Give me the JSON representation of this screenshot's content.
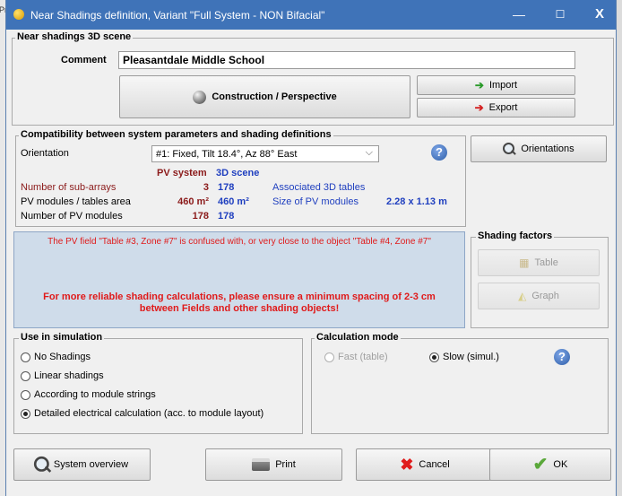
{
  "background_app": {
    "left_text": "Pr"
  },
  "window": {
    "title": "Near Shadings definition, Variant \"Full System - NON Bifacial\"",
    "min_glyph": "—",
    "max_glyph": "☐",
    "close_glyph": "X"
  },
  "scene": {
    "legend": "Near shadings 3D scene",
    "comment_label": "Comment",
    "comment_value": "Pleasantdale Middle School",
    "construction_label": "Construction / Perspective",
    "import_label": "Import",
    "export_label": "Export"
  },
  "compat": {
    "legend": "Compatibility between system parameters and shading definitions",
    "orientation_label": "Orientation",
    "orientation_value": "#1: Fixed, Tilt 18.4°, Az 88° East",
    "col_pv": "PV system",
    "col_3d": "3D scene",
    "rows": [
      {
        "label": "Number of sub-arrays",
        "pv": "3",
        "scene": "178"
      },
      {
        "label": "PV modules / tables area",
        "pv": "460 m²",
        "scene": "460 m²"
      },
      {
        "label": "Number of PV modules",
        "pv": "178",
        "scene": "178"
      }
    ],
    "assoc_label": "Associated 3D tables",
    "size_label": "Size of PV modules",
    "size_value": "2.28 x 1.13 m",
    "orientations_button": "Orientations"
  },
  "messages": {
    "warning": "The PV field \"Table #3, Zone #7\" is confused with, or very close to the object \"Table #4, Zone #7\"",
    "advice_line1": "For more reliable shading calculations, please ensure a minimum spacing of 2-3 cm",
    "advice_line2": "between Fields and other shading objects!"
  },
  "shading_factors": {
    "legend": "Shading factors",
    "table_label": "Table",
    "graph_label": "Graph"
  },
  "use_in_simulation": {
    "legend": "Use in simulation",
    "options": [
      {
        "label": "No Shadings",
        "selected": false
      },
      {
        "label": "Linear shadings",
        "selected": false
      },
      {
        "label": "According to module strings",
        "selected": false
      },
      {
        "label": "Detailed electrical calculation (acc. to module layout)",
        "selected": true
      }
    ]
  },
  "calc_mode": {
    "legend": "Calculation mode",
    "fast_label": "Fast (table)",
    "slow_label": "Slow (simul.)",
    "selected": "slow"
  },
  "footer": {
    "overview_label": "System overview",
    "print_label": "Print",
    "cancel_label": "Cancel",
    "ok_label": "OK"
  },
  "colors": {
    "titlebar": "#3f73b8",
    "red_text": "#8b1a1a",
    "blue_text": "#1f3fbf",
    "alert_red": "#e01a1a",
    "message_bg": "#cfdcea"
  }
}
